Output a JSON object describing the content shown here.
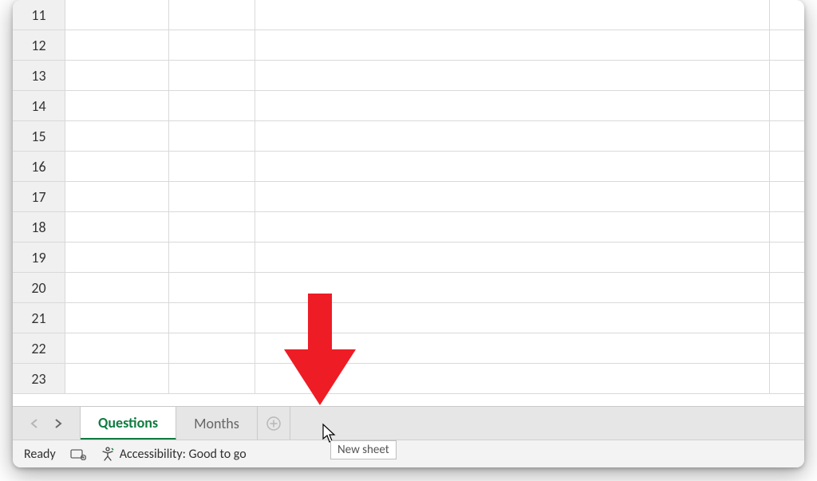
{
  "rows": [
    11,
    12,
    13,
    14,
    15,
    16,
    17,
    18,
    19,
    20,
    21,
    22,
    23
  ],
  "sheet_tabs": {
    "active": "Questions",
    "inactive": "Months"
  },
  "tooltip": "New sheet",
  "status": {
    "ready": "Ready",
    "accessibility": "Accessibility: Good to go"
  },
  "annotation": {
    "arrow_color": "#EE1C25"
  }
}
